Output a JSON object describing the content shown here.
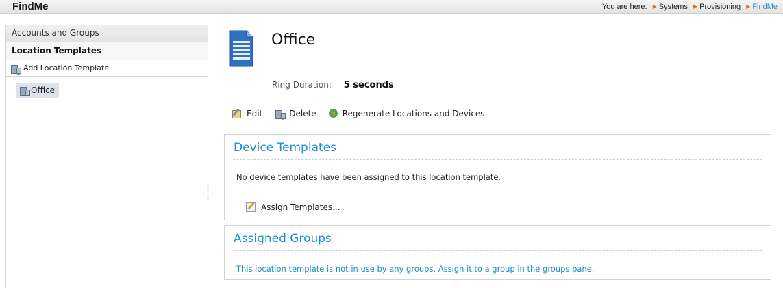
{
  "header": {
    "app_title": "FindMe",
    "breadcrumb_prefix": "You are here:",
    "breadcrumb": [
      "Systems",
      "Provisioning",
      "FindMe"
    ]
  },
  "sidebar": {
    "accounts_label": "Accounts and Groups",
    "location_templates_label": "Location Templates",
    "add_location_label": "Add Location Template",
    "tree_items": [
      "Office"
    ]
  },
  "main": {
    "title": "Office",
    "ring_duration_label": "Ring Duration:",
    "ring_duration_value": "5 seconds",
    "actions": {
      "edit": "Edit",
      "delete": "Delete",
      "regenerate": "Regenerate Locations and Devices"
    },
    "device_templates": {
      "title": "Device Templates",
      "empty_message": "No device templates have been assigned to this location template.",
      "assign_label": "Assign Templates..."
    },
    "assigned_groups": {
      "title": "Assigned Groups",
      "message": "This location template is not in use by any groups. Assign it to a group in the groups pane."
    }
  },
  "colors": {
    "accent_blue": "#1b8fce",
    "breadcrumb_arrow": "#e2731b",
    "selected_item_bg": "#dde3ec"
  }
}
